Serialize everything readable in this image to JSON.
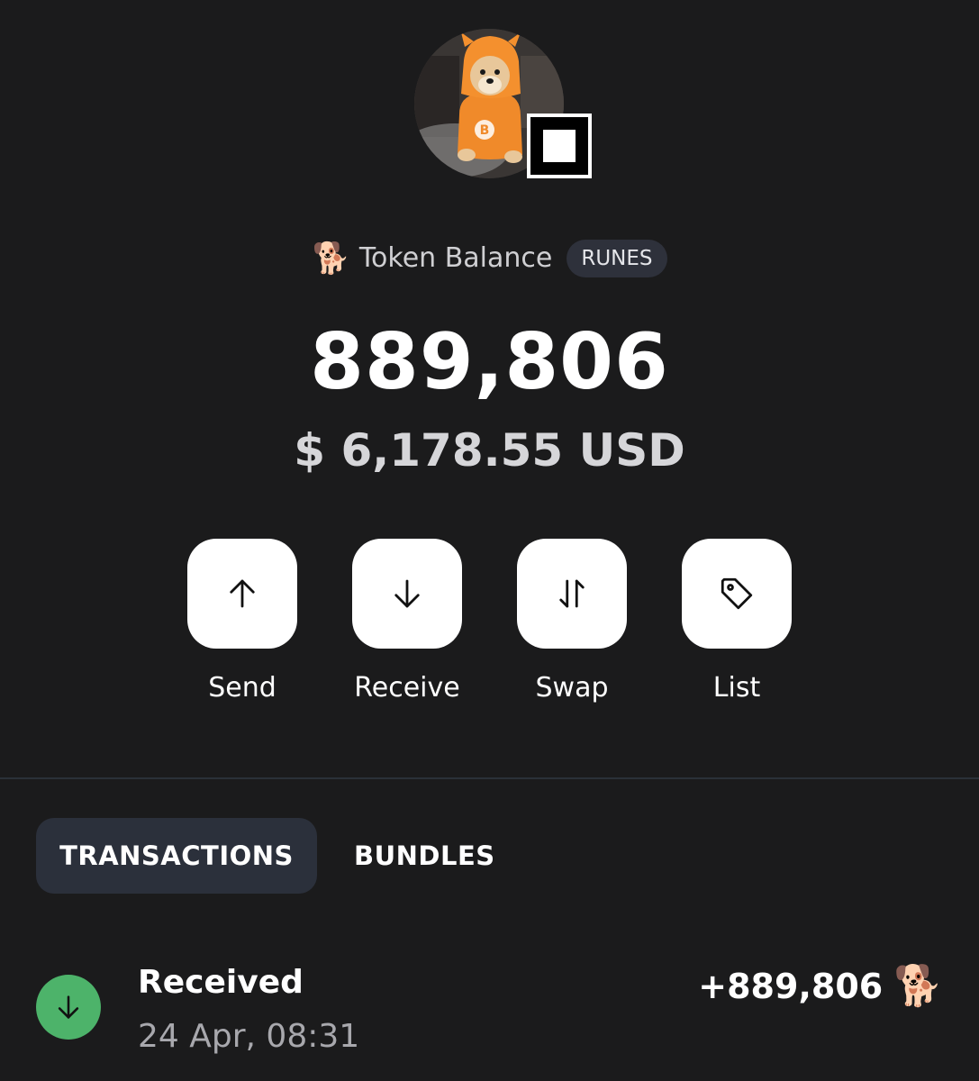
{
  "token": {
    "emoji": "🐕",
    "label": "Token Balance",
    "tag": "RUNES",
    "balance": "889,806",
    "usd_value": "$ 6,178.55 USD"
  },
  "actions": [
    {
      "label": "Send",
      "icon": "arrow-up-icon"
    },
    {
      "label": "Receive",
      "icon": "arrow-down-icon"
    },
    {
      "label": "Swap",
      "icon": "swap-icon"
    },
    {
      "label": "List",
      "icon": "tag-icon"
    }
  ],
  "tabs": [
    {
      "label": "TRANSACTIONS",
      "active": true
    },
    {
      "label": "BUNDLES",
      "active": false
    }
  ],
  "transactions": [
    {
      "type": "Received",
      "date": "24 Apr, 08:31",
      "amount": "+889,806",
      "emoji": "🐕",
      "icon": "arrow-down-icon",
      "icon_color": "#4db36a"
    }
  ],
  "colors": {
    "background": "#1b1b1c",
    "tag_bg": "#2e313b",
    "active_tab_bg": "#2b303b",
    "received_green": "#4db36a"
  }
}
